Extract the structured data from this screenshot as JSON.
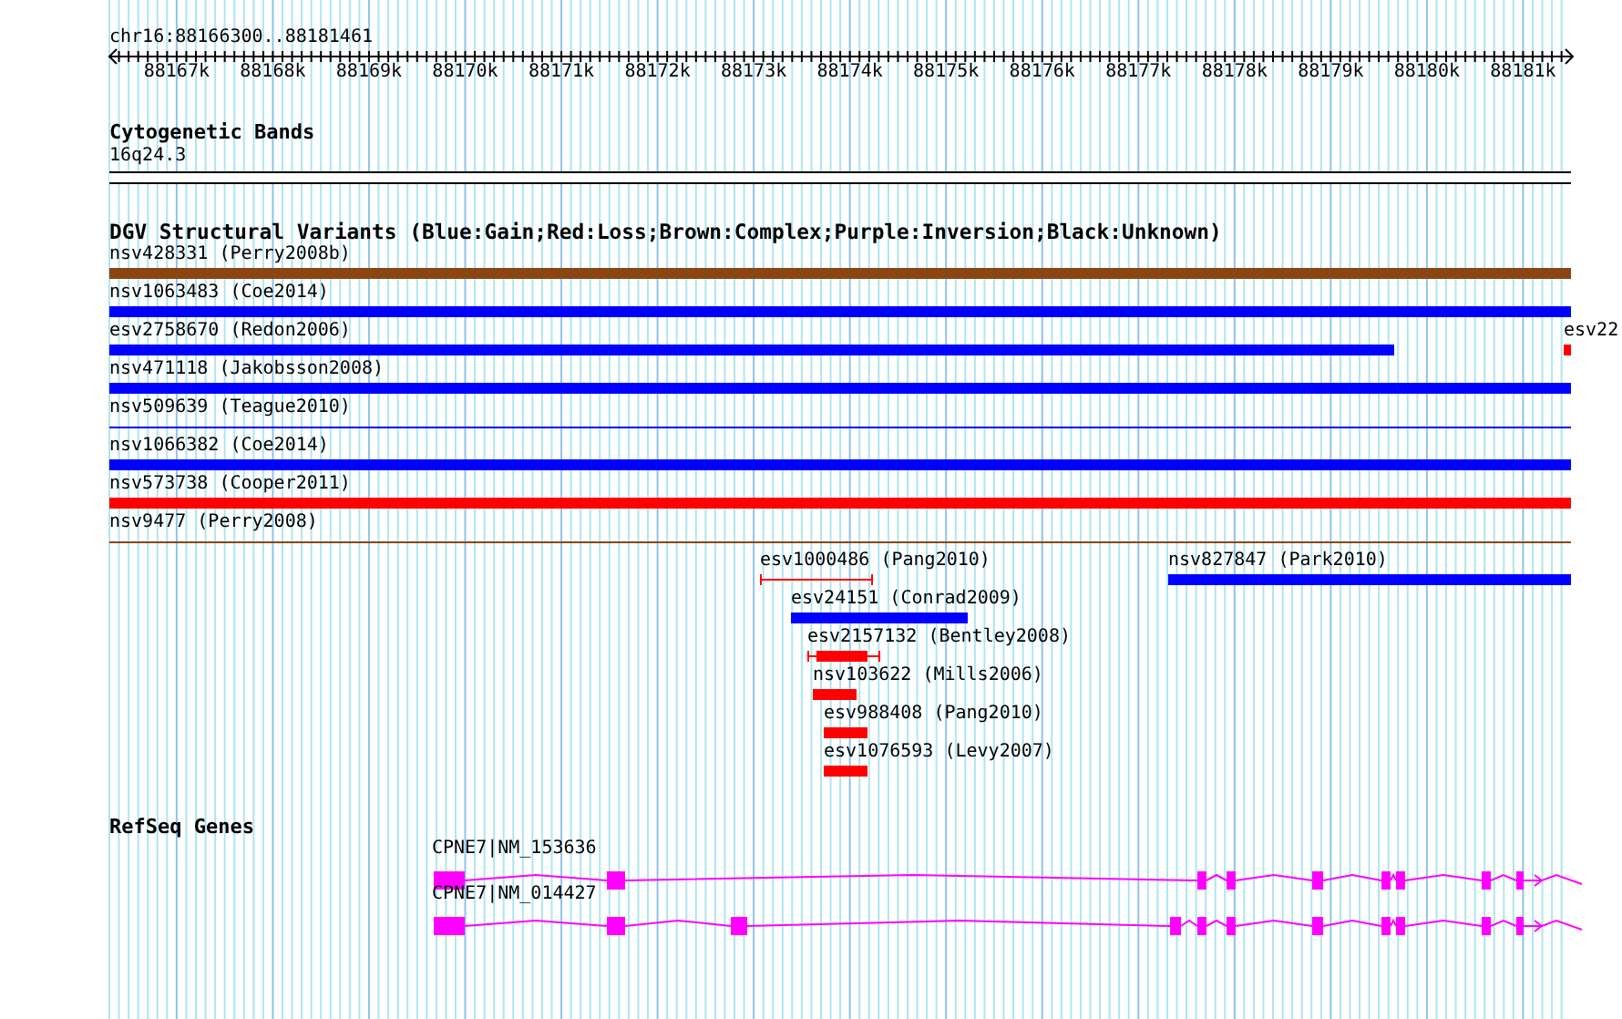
{
  "ruler": {
    "range": "chr16:88166300..88181461",
    "ticks": [
      "88167k",
      "88168k",
      "88169k",
      "88170k",
      "88171k",
      "88172k",
      "88173k",
      "88174k",
      "88175k",
      "88176k",
      "88177k",
      "88178k",
      "88179k",
      "88180k",
      "88181k"
    ]
  },
  "cytogenetic_bands": {
    "title": "Cytogenetic Bands",
    "band": "16q24.3"
  },
  "dgv": {
    "title": "DGV Structural Variants (Blue:Gain;Red:Loss;Brown:Complex;Purple:Inversion;Black:Unknown)",
    "variants": [
      {
        "label": "nsv428331 (Perry2008b)",
        "color": "#8b4513",
        "kind": "bar"
      },
      {
        "label": "nsv1063483 (Coe2014)",
        "color": "#0000ff",
        "kind": "bar"
      },
      {
        "label": "esv2758670 (Redon2006)",
        "color": "#0000ff",
        "kind": "bar"
      },
      {
        "label": "esv22",
        "color": "#ff0000",
        "kind": "bar"
      },
      {
        "label": "nsv471118 (Jakobsson2008)",
        "color": "#0000ff",
        "kind": "bar"
      },
      {
        "label": "nsv509639 (Teague2010)",
        "color": "#0000ff",
        "kind": "line"
      },
      {
        "label": "nsv1066382 (Coe2014)",
        "color": "#0000ff",
        "kind": "bar"
      },
      {
        "label": "nsv573738 (Cooper2011)",
        "color": "#ff0000",
        "kind": "bar"
      },
      {
        "label": "nsv9477 (Perry2008)",
        "color": "#8b4513",
        "kind": "line"
      },
      {
        "label": "esv1000486 (Pang2010)",
        "color": "#ff0000",
        "kind": "capped"
      },
      {
        "label": "nsv827847 (Park2010)",
        "color": "#0000ff",
        "kind": "bar"
      },
      {
        "label": "esv24151 (Conrad2009)",
        "color": "#0000ff",
        "kind": "bar"
      },
      {
        "label": "esv2157132 (Bentley2008)",
        "color": "#ff0000",
        "kind": "capped_bar"
      },
      {
        "label": "nsv103622 (Mills2006)",
        "color": "#ff0000",
        "kind": "bar"
      },
      {
        "label": "esv988408 (Pang2010)",
        "color": "#ff0000",
        "kind": "bar"
      },
      {
        "label": "esv1076593 (Levy2007)",
        "color": "#ff0000",
        "kind": "bar"
      }
    ]
  },
  "refseq_genes": {
    "title": "RefSeq Genes",
    "genes": [
      {
        "label": "CPNE7|NM_153636"
      },
      {
        "label": "CPNE7|NM_014427"
      }
    ]
  }
}
